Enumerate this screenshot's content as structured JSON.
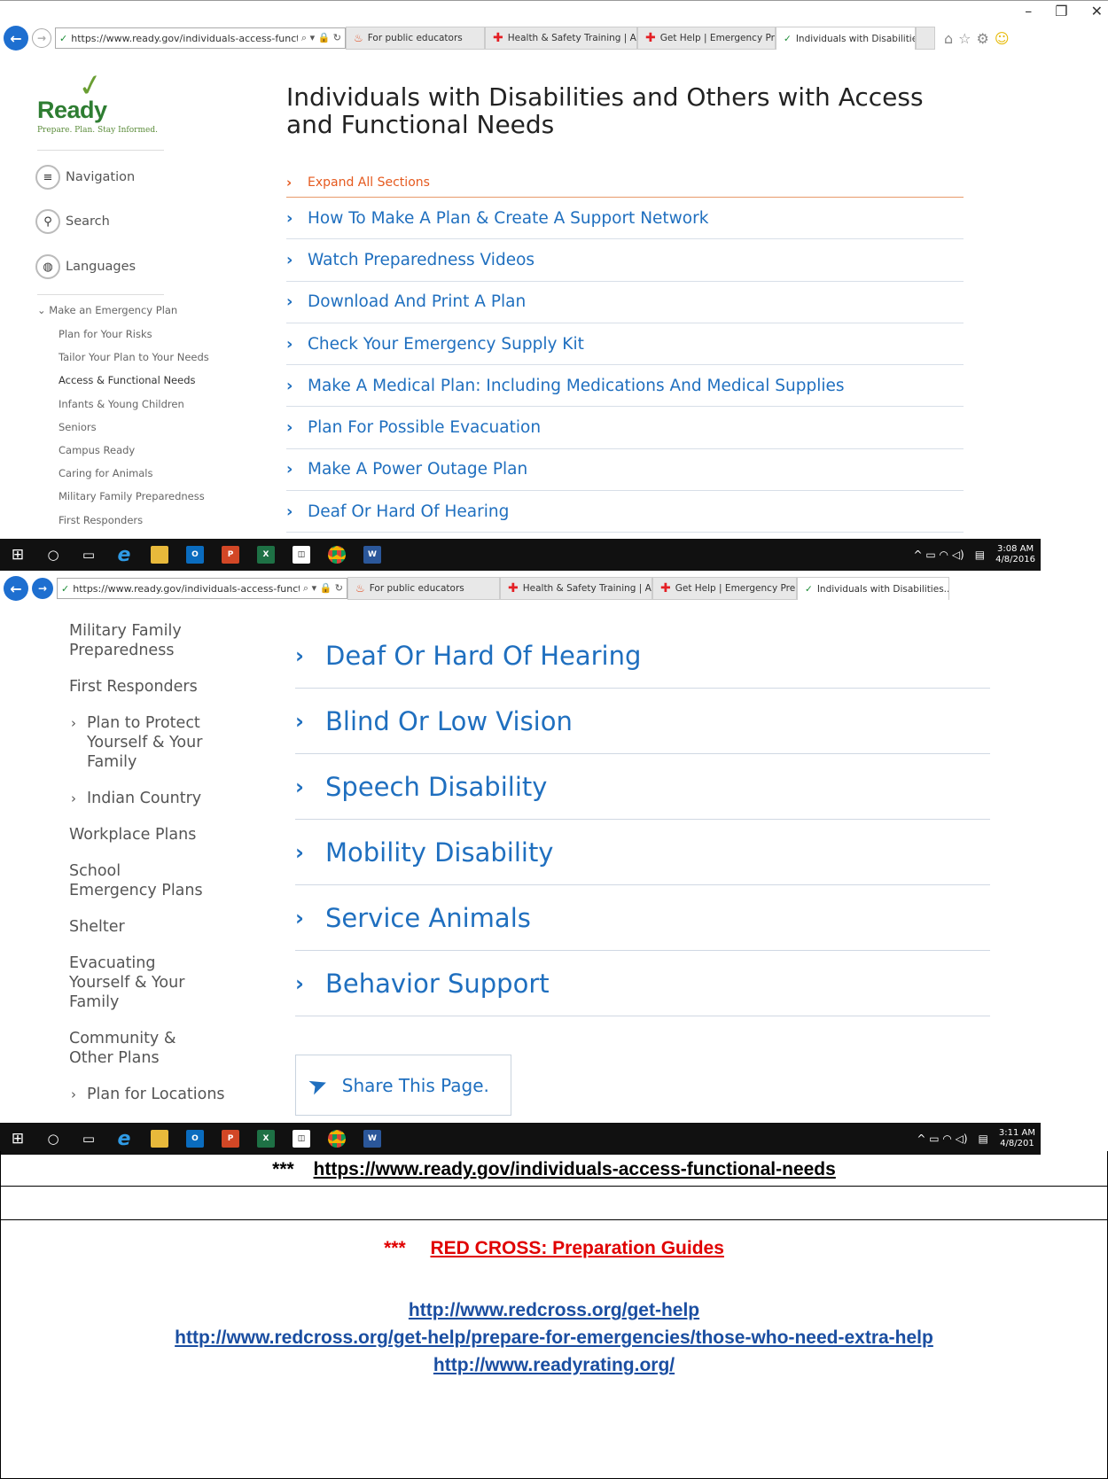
{
  "browser1": {
    "url": "https://www.ready.gov/individuals-access-functior",
    "window_controls": [
      "–",
      "❐",
      "✕"
    ],
    "tabs": [
      {
        "label": "For public educators",
        "icon": "fire-icon"
      },
      {
        "label": "Health & Safety Training | Am...",
        "icon": "red-cross-icon"
      },
      {
        "label": "Get Help | Emergency Prepare...",
        "icon": "red-cross-icon"
      },
      {
        "label": "Individuals with Disabilities...",
        "icon": "check-icon",
        "active": true
      }
    ]
  },
  "site": {
    "logo_word": "Ready",
    "logo_tagline": "Prepare. Plan. Stay Informed.",
    "nav_label": "Navigation",
    "search_label": "Search",
    "languages_label": "Languages",
    "menu_parent": "Make an Emergency Plan",
    "menu_items": [
      "Plan for Your Risks",
      "Tailor Your Plan to Your Needs",
      "Access & Functional Needs",
      "Infants & Young Children",
      "Seniors",
      "Campus Ready",
      "Caring for Animals",
      "Military Family Preparedness",
      "First Responders"
    ],
    "page_title": "Individuals with Disabilities and Others with Access and Functional Needs",
    "expand_all": "Expand All Sections",
    "sections": [
      "How To Make A Plan & Create A Support Network",
      "Watch Preparedness Videos",
      "Download And Print A Plan",
      "Check Your Emergency Supply Kit",
      "Make A Medical Plan: Including Medications And Medical Supplies",
      "Plan For Possible Evacuation",
      "Make A Power Outage Plan",
      "Deaf Or Hard Of Hearing"
    ]
  },
  "taskbar1": {
    "time": "3:08 AM",
    "date": "4/8/2016"
  },
  "browser2": {
    "url": "https://www.ready.gov/individuals-access-functior",
    "tabs": [
      {
        "label": "For public educators"
      },
      {
        "label": "Health & Safety Training | Am..."
      },
      {
        "label": "Get Help | Emergency Prepare..."
      },
      {
        "label": "Individuals with Disabilities..."
      }
    ]
  },
  "site2": {
    "sidebar": [
      {
        "label": "Military Family Preparedness"
      },
      {
        "label": "First Responders"
      },
      {
        "label": "Plan to Protect Yourself & Your Family",
        "sub": true
      },
      {
        "label": "Indian Country",
        "sub": true
      },
      {
        "label": "Workplace Plans"
      },
      {
        "label": "School Emergency Plans"
      },
      {
        "label": "Shelter"
      },
      {
        "label": "Evacuating Yourself & Your Family"
      },
      {
        "label": "Community & Other Plans"
      },
      {
        "label": "Plan for Locations",
        "sub": true
      }
    ],
    "sections": [
      "Deaf Or Hard Of Hearing",
      "Blind Or Low Vision",
      "Speech Disability",
      "Mobility Disability",
      "Service Animals",
      "Behavior Support"
    ],
    "share_label": "Share This Page."
  },
  "taskbar2": {
    "time": "3:11 AM",
    "date": "4/8/201"
  },
  "document": {
    "stars": "***",
    "ready_link": "https://www.ready.gov/individuals-access-functional-needs",
    "redcross_heading": "RED CROSS: Preparation Guides",
    "links": [
      "http://www.redcross.org/get-help",
      "http://www.redcross.org/get-help/prepare-for-emergencies/those-who-need-extra-help",
      "http://www.readyrating.org/"
    ]
  }
}
